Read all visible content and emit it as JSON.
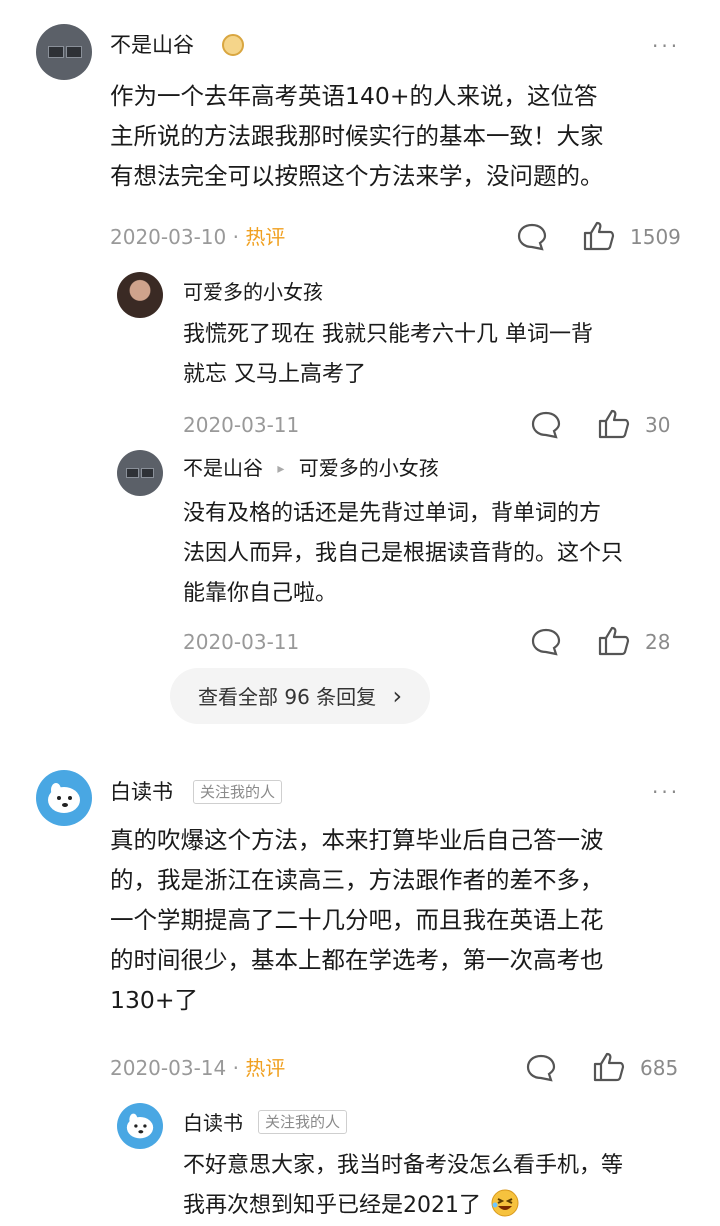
{
  "comments": [
    {
      "author": "不是山谷",
      "text_lines": [
        "作为一个去年高考英语140+的人来说，这位答",
        "主所说的方法跟我那时候实行的基本一致！大家",
        "有想法完全可以按照这个方法来学，没问题的。"
      ],
      "date": "2020-03-10",
      "sep": "·",
      "hot_label": "热评",
      "likes": "1509",
      "more": "···",
      "replies": [
        {
          "author": "可爱多的小女孩",
          "text_lines": [
            "我慌死了现在 我就只能考六十几 单词一背",
            "就忘 又马上高考了"
          ],
          "date": "2020-03-11",
          "likes": "30"
        },
        {
          "author": "不是山谷",
          "reply_to": "可爱多的小女孩",
          "arrow": "▸",
          "text_lines": [
            "没有及格的话还是先背过单词，背单词的方",
            "法因人而异，我自己是根据读音背的。这个只",
            "能靠你自己啦。"
          ],
          "date": "2020-03-11",
          "likes": "28"
        }
      ],
      "view_all": "查看全部 96 条回复",
      "view_all_arrow": "›"
    },
    {
      "author": "白读书",
      "tag": "关注我的人",
      "text_lines": [
        "真的吹爆这个方法，本来打算毕业后自己答一波",
        "的，我是浙江在读高三，方法跟作者的差不多，",
        "一个学期提高了二十几分吧，而且我在英语上花",
        "的时间很少，基本上都在学选考，第一次高考也",
        "130+了"
      ],
      "date": "2020-03-14",
      "sep": "·",
      "hot_label": "热评",
      "likes": "685",
      "more": "···",
      "replies": [
        {
          "author": "白读书",
          "tag": "关注我的人",
          "text_lines": [
            "不好意思大家，我当时备考没怎么看手机，等",
            "我再次想到知乎已经是2021了"
          ],
          "date": "",
          "likes": ""
        }
      ]
    }
  ],
  "colors": {
    "hot": "#f0a020",
    "meta": "#999999",
    "text": "#1a1a1a"
  },
  "icons": [
    "crown-badge-icon",
    "comment-icon",
    "like-icon",
    "more-icon",
    "laugh-emoji-icon",
    "chevron-right-icon"
  ]
}
